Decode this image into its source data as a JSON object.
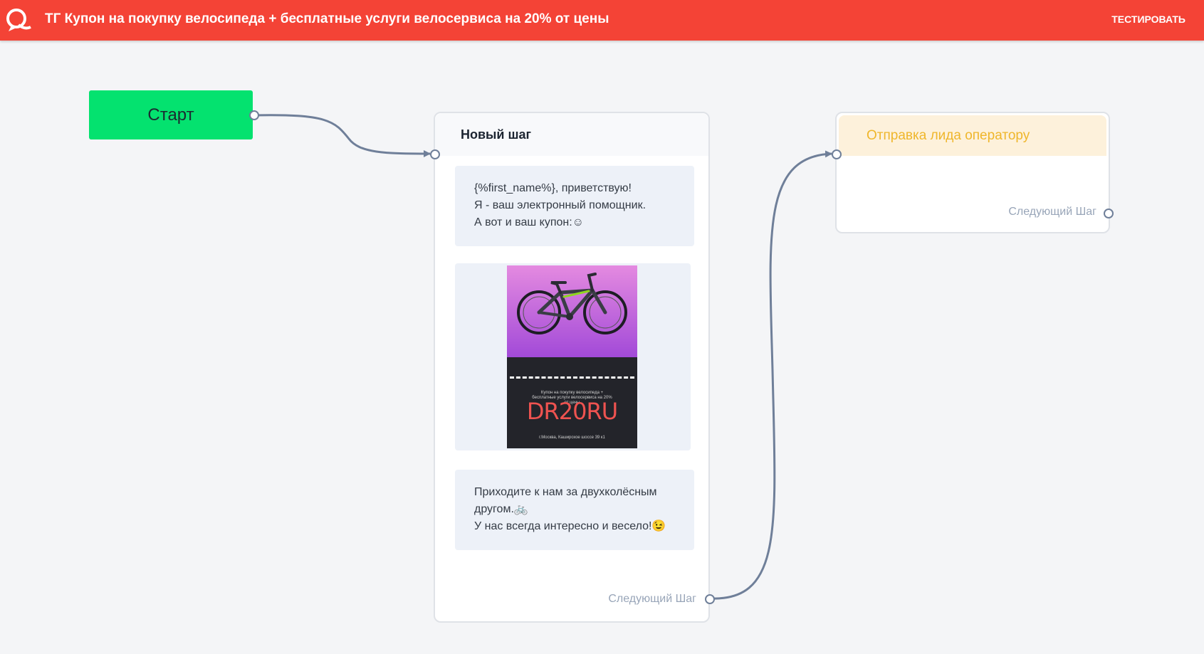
{
  "header": {
    "logo_icon": "chat-logo-icon",
    "title": "ТГ Купон на покупку велосипеда + бесплатные услуги велосервиса на 20% от цены",
    "test_button": "ТЕСТИРОВАТЬ"
  },
  "colors": {
    "header_bg": "#f44336",
    "start_bg": "#04e26f",
    "link": "#6f7f99",
    "operator_head_bg": "#fdf1db",
    "operator_head_text": "#efb62b"
  },
  "start_node": {
    "label": "Старт"
  },
  "step_node": {
    "title": "Новый шаг",
    "message1_lines": [
      "{%first_name%}, приветствую!",
      "Я - ваш электронный помощник.",
      "А вот и ваш купон:☺"
    ],
    "coupon": {
      "image_icon": "bicycle-image",
      "caption_line1": "Купон на покупку велосипеда +",
      "caption_line2": "бесплатные услуги велосервиса на 20%",
      "caption_line3": "от цены",
      "code": "DR20RU",
      "address": "г.Москва, Каширское шоссе 39 к1"
    },
    "message3_lines": [
      "Приходите к нам за двухколёсным",
      "другом.🚲",
      "У нас всегда интересно и весело!😉"
    ],
    "next_step_label": "Следующий Шаг"
  },
  "operator_node": {
    "title": "Отправка лида оператору",
    "next_step_label": "Следующий Шаг"
  }
}
